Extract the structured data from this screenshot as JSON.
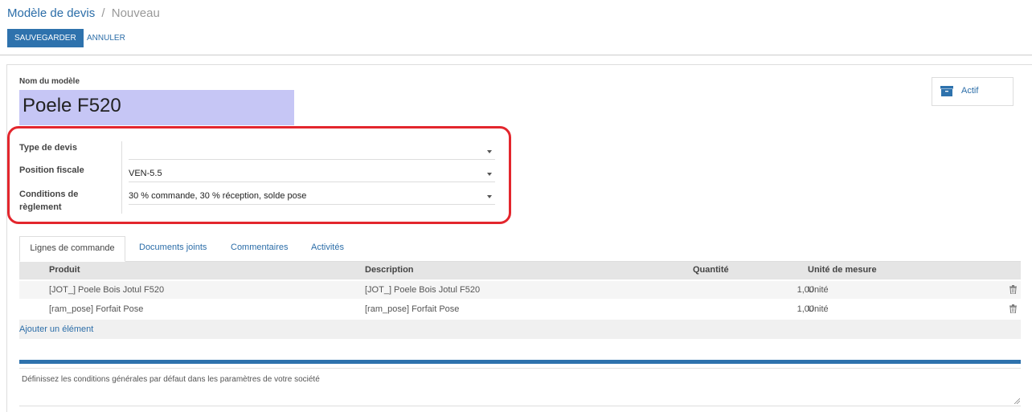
{
  "breadcrumb": {
    "parent": "Modèle de devis",
    "separator": "/",
    "current": "Nouveau"
  },
  "toolbar": {
    "save_label": "SAUVEGARDER",
    "cancel_label": "ANNULER"
  },
  "form": {
    "name_label": "Nom du modèle",
    "name_value": "Poele F520",
    "active_button": "Actif",
    "fields": [
      {
        "label": "Type de devis",
        "value": ""
      },
      {
        "label": "Position fiscale",
        "value": "VEN-5.5"
      },
      {
        "label_line1": "Conditions de",
        "label_line2": "règlement",
        "value": "30 % commande, 30 % réception, solde pose"
      }
    ]
  },
  "tabs": [
    "Lignes de commande",
    "Documents joints",
    "Commentaires",
    "Activités"
  ],
  "table": {
    "columns": [
      "Produit",
      "Description",
      "Quantité",
      "Unité de mesure"
    ],
    "rows": [
      {
        "product": "[JOT_] Poele Bois Jotul F520",
        "description": "[JOT_] Poele Bois Jotul F520",
        "quantity": "1,00",
        "uom": "Unité"
      },
      {
        "product": "[ram_pose] Forfait Pose",
        "description": "[ram_pose] Forfait Pose",
        "quantity": "1,00",
        "uom": "Unité"
      }
    ],
    "add_line": "Ajouter un élément"
  },
  "notes": {
    "placeholder": "Définissez les conditions générales par défaut dans les paramètres de votre société"
  },
  "colors": {
    "primary": "#2e72ad",
    "link": "#2b6da8",
    "highlight": "#e3262d",
    "title_bg": "#c6c6f5"
  },
  "icons": {
    "active": "archive-icon",
    "delete": "trash-icon"
  }
}
